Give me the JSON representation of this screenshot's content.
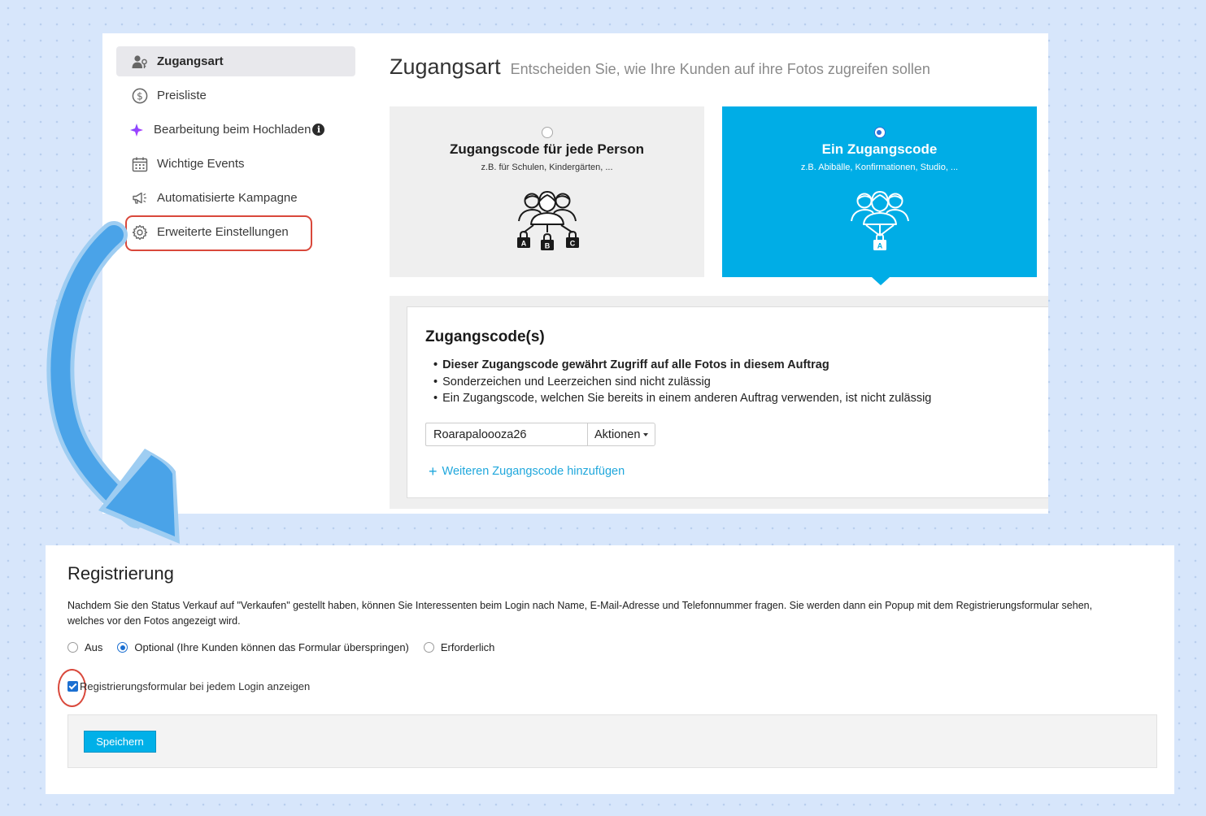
{
  "sidebar": {
    "items": [
      {
        "label": "Zugangsart",
        "icon": "users-key-icon"
      },
      {
        "label": "Preisliste",
        "icon": "dollar-circle-icon"
      },
      {
        "label": "Bearbeitung beim Hochladen",
        "icon": "sparkle-icon",
        "info": "i"
      },
      {
        "label": "Wichtige Events",
        "icon": "calendar-icon"
      },
      {
        "label": "Automatisierte Kampagne",
        "icon": "megaphone-icon"
      },
      {
        "label": "Erweiterte Einstellungen",
        "icon": "gear-icon"
      }
    ]
  },
  "access": {
    "title": "Zugangsart",
    "subtitle": "Entscheiden Sie, wie Ihre Kunden auf ihre Fotos zugreifen sollen",
    "options": [
      {
        "title": "Zugangscode für jede Person",
        "subtitle": "z.B. für Schulen, Kindergärten, ...",
        "selected": false,
        "lock_letters": [
          "A",
          "B",
          "C"
        ]
      },
      {
        "title": "Ein Zugangscode",
        "subtitle": "z.B. Abibälle, Konfirmationen, Studio, ...",
        "selected": true,
        "lock_letters": [
          "A"
        ]
      }
    ]
  },
  "codes": {
    "title": "Zugangscode(s)",
    "rules": [
      "Dieser Zugangscode gewährt Zugriff auf alle Fotos in diesem Auftrag",
      "Sonderzeichen und Leerzeichen sind nicht zulässig",
      "Ein Zugangscode, welchen Sie bereits in einem anderen Auftrag verwenden, ist nicht zulässig"
    ],
    "code_value": "Roarapaloooza26",
    "actions_label": "Aktionen",
    "add_link": "Weiteren Zugangscode hinzufügen"
  },
  "registration": {
    "title": "Registrierung",
    "description": "Nachdem Sie den Status Verkauf auf \"Verkaufen\" gestellt haben, können Sie Interessenten beim Login nach Name, E-Mail-Adresse und Telefonnummer fragen. Sie werden dann ein Popup mit dem Registrierungsformular sehen, welches vor den Fotos angezeigt wird.",
    "options": [
      {
        "label": "Aus",
        "selected": false
      },
      {
        "label": "Optional (Ihre Kunden können das Formular überspringen)",
        "selected": true
      },
      {
        "label": "Erforderlich",
        "selected": false
      }
    ],
    "checkbox_label": "Registrierungsformular bei jedem Login anzeigen",
    "checkbox_checked": true,
    "save_label": "Speichern"
  },
  "colors": {
    "accent": "#00ade6",
    "highlight": "#d9483b",
    "arrow": "#4aa3e8",
    "background": "#d7e6fb"
  }
}
